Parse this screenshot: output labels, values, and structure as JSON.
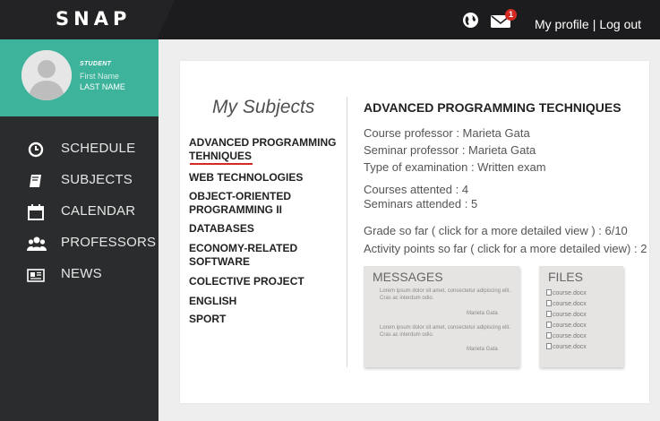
{
  "header": {
    "logo": "SNAP",
    "notification_count": "1",
    "my_profile": "My profile",
    "separator": "|",
    "logout": "Log out",
    "globe_icon": "globe-icon",
    "mail_icon": "mail-icon"
  },
  "user": {
    "role": "STUDENT",
    "first_name": "First Name",
    "last_name": "LAST NAME"
  },
  "nav": [
    {
      "label": "SCHEDULE",
      "icon": "clock-icon"
    },
    {
      "label": "SUBJECTS",
      "icon": "book-icon"
    },
    {
      "label": "CALENDAR",
      "icon": "calendar-icon"
    },
    {
      "label": "PROFESSORS",
      "icon": "people-icon"
    },
    {
      "label": "NEWS",
      "icon": "news-icon"
    }
  ],
  "subjects_heading": "My Subjects",
  "subjects": [
    "ADVANCED PROGRAMMING TEHNIQUES",
    "WEB TECHNOLOGIES",
    "OBJECT-ORIENTED PROGRAMMING II",
    "DATABASES",
    "ECONOMY-RELATED SOFTWARE",
    "COLECTIVE PROJECT",
    "ENGLISH",
    "SPORT"
  ],
  "detail": {
    "title": "ADVANCED PROGRAMMING TECHNIQUES",
    "course_professor": "Course professor : Marieta Gata",
    "seminar_professor": "Seminar professor : Marieta Gata",
    "exam_type": "Type of examination : Written exam",
    "courses_attended": "Courses attented : 4",
    "seminars_attended": "Seminars attended : 5",
    "grade": "Grade so far ( click for a more detailed view ) : 6/10",
    "activity": "Activity points so far ( click for a more detailed view) : 2"
  },
  "messages": {
    "title": "MESSAGES",
    "items": [
      {
        "text": "Lorem ipsum dolor sit amet, consectetur adipiscing elit. Cras ac interdum odio.",
        "author": "Marieta Gata"
      },
      {
        "text": "Lorem ipsum dolor sit amet, consectetur adipiscing elit. Cras ac interdum odio.",
        "author": "Marieta Gata"
      }
    ]
  },
  "files": {
    "title": "FILES",
    "items": [
      "course.docx",
      "course.docx",
      "course.docx",
      "course.docx",
      "course.docx",
      "course.docx"
    ]
  },
  "colors": {
    "accent": "#3db39b",
    "dark": "#1c1c1e",
    "sidebar": "#2a2c2d",
    "badge": "#d42a23"
  }
}
